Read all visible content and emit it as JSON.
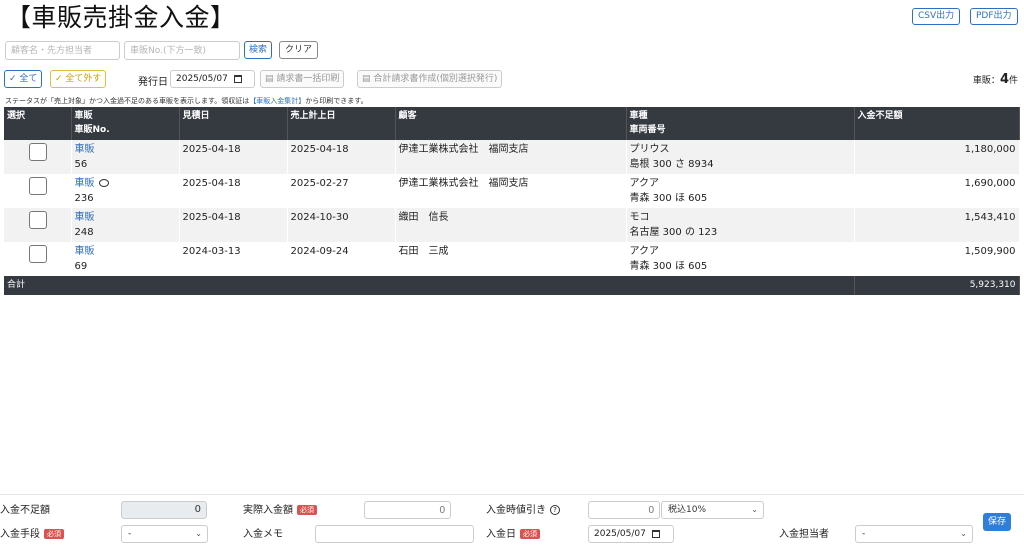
{
  "header": {
    "title": "【車販売掛金入金】",
    "csv_label": "CSV出力",
    "pdf_label": "PDF出力"
  },
  "search": {
    "customer_placeholder": "顧客名・先方担当者",
    "number_placeholder": "車販No.(下方一致)",
    "search_label": "検索",
    "clear_label": "クリア"
  },
  "toolbar": {
    "select_all_label": "全て",
    "deselect_all_label": "全て外す",
    "issue_date_label": "発行日",
    "issue_date_value": "2025/05/07",
    "bulk_print_label": "請求書一括印刷",
    "combined_invoice_label": "合計請求書作成(個別選択発行)",
    "count_prefix": "車販：",
    "count_value": "4",
    "count_suffix": "件"
  },
  "note": {
    "text_before": "ステータスが「売上対象」かつ入金過不足のある車販を表示します。領収証は",
    "link_text": "【車販入金集計】",
    "text_after": "から印刷できます。"
  },
  "table": {
    "headers": {
      "select": "選択",
      "sale": "車販",
      "sale_no": "車販No.",
      "estimate_date": "見積日",
      "sales_date": "売上計上日",
      "customer": "顧客",
      "model": "車種",
      "plate": "車両番号",
      "shortage": "入金不足額"
    },
    "rows": [
      {
        "link": "車販",
        "no": "56",
        "estimate": "2025-04-18",
        "sales": "2025-04-18",
        "customer": "伊達工業株式会社　福岡支店",
        "model": "プリウス",
        "plate": "島根 300 さ 8934",
        "amount": "1,180,000"
      },
      {
        "link": "車販",
        "no": "236",
        "estimate": "2025-04-18",
        "sales": "2025-02-27",
        "customer": "伊達工業株式会社　福岡支店",
        "model": "アクア",
        "plate": "青森 300 ほ 605",
        "amount": "1,690,000"
      },
      {
        "link": "車販",
        "no": "248",
        "estimate": "2025-04-18",
        "sales": "2024-10-30",
        "customer": "織田　信長",
        "model": "モコ",
        "plate": "名古屋 300 の 123",
        "amount": "1,543,410"
      },
      {
        "link": "車販",
        "no": "69",
        "estimate": "2024-03-13",
        "sales": "2024-09-24",
        "customer": "石田　三成",
        "model": "アクア",
        "plate": "青森 300 ほ 605",
        "amount": "1,509,900"
      }
    ],
    "total_label": "合計",
    "total_value": "5,923,310"
  },
  "footer": {
    "shortage_label": "入金不足額",
    "shortage_value": "0",
    "actual_label": "実際入金額",
    "actual_placeholder": "0",
    "discount_label": "入金時値引き",
    "discount_placeholder": "0",
    "tax_value": "税込10%",
    "method_label": "入金手段",
    "method_value": "-",
    "memo_label": "入金メモ",
    "date_label": "入金日",
    "date_value": "2025/05/07",
    "staff_label": "入金担当者",
    "staff_value": "-",
    "required_badge": "必須",
    "save_label": "保存"
  }
}
